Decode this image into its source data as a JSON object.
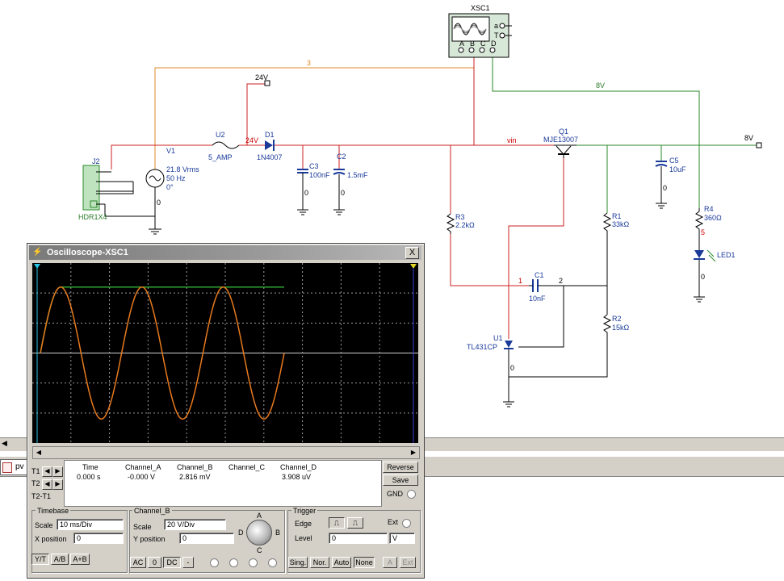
{
  "schematic": {
    "scope_name": "XSC1",
    "scope_pins": {
      "a": "a",
      "t": "T"
    },
    "scope_channels": [
      "A",
      "B",
      "C",
      "D"
    ],
    "net_labels": {
      "net3": "3",
      "net24v_top": "24V",
      "net24v": "24V",
      "vin": "vin",
      "net8v_green": "8V",
      "net8v_out": "8V",
      "net1": "1",
      "net2": "2",
      "net5": "5",
      "gnd0_v1": "0",
      "gnd0_c3": "0",
      "gnd0_c2": "0",
      "gnd0_c5": "0",
      "gnd0_led": "0",
      "gnd0_u1": "0"
    },
    "components": {
      "j2": {
        "ref": "J2",
        "value": "HDR1X4"
      },
      "v1": {
        "ref": "V1",
        "value1": "21.8 Vrms",
        "value2": "50 Hz",
        "value3": "0°"
      },
      "u2": {
        "ref": "U2",
        "value": "5_AMP"
      },
      "d1": {
        "ref": "D1",
        "value": "1N4007"
      },
      "c3": {
        "ref": "C3",
        "value": "100nF"
      },
      "c2": {
        "ref": "C2",
        "value": "1.5mF"
      },
      "q1": {
        "ref": "Q1",
        "value": "MJE13007"
      },
      "c5": {
        "ref": "C5",
        "value": "10uF"
      },
      "r4": {
        "ref": "R4",
        "value": "360Ω"
      },
      "led1": {
        "ref": "LED1"
      },
      "r3": {
        "ref": "R3",
        "value": "2.2kΩ"
      },
      "r1": {
        "ref": "R1",
        "value": "33kΩ"
      },
      "r2": {
        "ref": "R2",
        "value": "15kΩ"
      },
      "c1": {
        "ref": "C1",
        "value": "10nF"
      },
      "u1": {
        "ref": "U1",
        "value": "TL431CP"
      }
    }
  },
  "host": {
    "tab_label": "pv"
  },
  "oscilloscope": {
    "title": "Oscilloscope-XSC1",
    "close_glyph": "X",
    "cursors": {
      "t1": "T1",
      "t2": "T2",
      "t2t1": "T2-T1"
    },
    "readout": {
      "headers": [
        "Time",
        "Channel_A",
        "Channel_B",
        "Channel_C",
        "Channel_D"
      ],
      "row": [
        "0.000 s",
        "-0.000 V",
        "2.816 mV",
        "",
        "3.908 uV"
      ]
    },
    "buttons": {
      "reverse": "Reverse",
      "save": "Save",
      "gnd": "GND"
    },
    "timebase": {
      "title": "Timebase",
      "scale_label": "Scale",
      "scale_value": "10 ms/Div",
      "xpos_label": "X position",
      "xpos_value": "0",
      "modes": [
        "Y/T",
        "A/B",
        "A+B"
      ]
    },
    "channel": {
      "title": "Channel_B",
      "scale_label": "Scale",
      "scale_value": "20  V/Div",
      "ypos_label": "Y position",
      "ypos_value": "0",
      "coupling": [
        "AC",
        "0",
        "DC",
        "-"
      ],
      "knob_labels": {
        "a": "A",
        "b": "B",
        "c": "C",
        "d": "D"
      }
    },
    "trigger": {
      "title": "Trigger",
      "edge_label": "Edge",
      "ext_label": "Ext",
      "level_label": "Level",
      "level_value": "0",
      "level_unit": "V",
      "modes": [
        "Sing.",
        "Nor.",
        "Auto",
        "None"
      ],
      "a_btn": "A",
      "ext_btn": "Ext"
    },
    "traces": {
      "channel_a_color": "#2fa82f",
      "channel_b_color": "#e87a1e",
      "sine_cycles": 3,
      "sine_peak_divisions": 2.2,
      "dc_level_divisions": 2.2
    }
  }
}
